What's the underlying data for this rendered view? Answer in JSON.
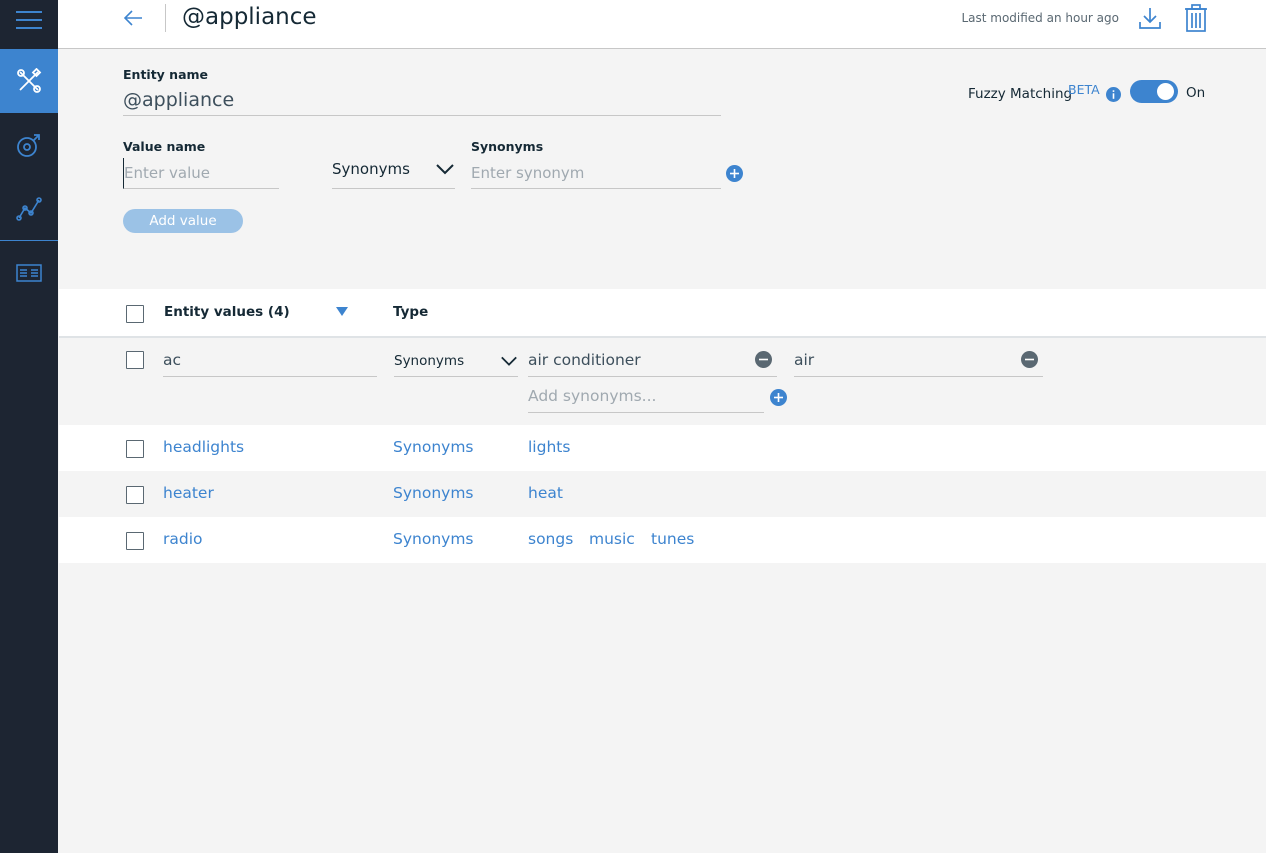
{
  "header": {
    "title": "@appliance",
    "last_modified": "Last modified an hour ago"
  },
  "entity": {
    "name_label": "Entity name",
    "name_value": "@appliance"
  },
  "fuzzy": {
    "label": "Fuzzy Matching",
    "beta": "BETA",
    "state": "On"
  },
  "add_form": {
    "value_label": "Value name",
    "value_placeholder": "Enter value",
    "type_selected": "Synonyms",
    "synonyms_label": "Synonyms",
    "synonym_placeholder": "Enter synonym",
    "add_button": "Add value"
  },
  "table": {
    "col_values": "Entity values (4)",
    "col_type": "Type",
    "editing_row": {
      "value": "ac",
      "type": "Synonyms",
      "synonyms": [
        "air conditioner",
        "air"
      ],
      "add_placeholder": "Add synonyms..."
    },
    "rows": [
      {
        "value": "headlights",
        "type": "Synonyms",
        "synonyms": [
          "lights"
        ]
      },
      {
        "value": "heater",
        "type": "Synonyms",
        "synonyms": [
          "heat"
        ]
      },
      {
        "value": "radio",
        "type": "Synonyms",
        "synonyms": [
          "songs",
          "music",
          "tunes"
        ]
      }
    ]
  },
  "sidebar": {
    "items": [
      {
        "icon": "hamburger-menu-icon"
      },
      {
        "icon": "tools-icon",
        "active": true
      },
      {
        "icon": "dialog-icon"
      },
      {
        "icon": "analytics-icon"
      },
      {
        "icon": "catalog-icon"
      }
    ]
  },
  "colors": {
    "accent": "#3d84cf",
    "sidebar": "#1d2532",
    "button_disabled": "#9bc2e6"
  }
}
